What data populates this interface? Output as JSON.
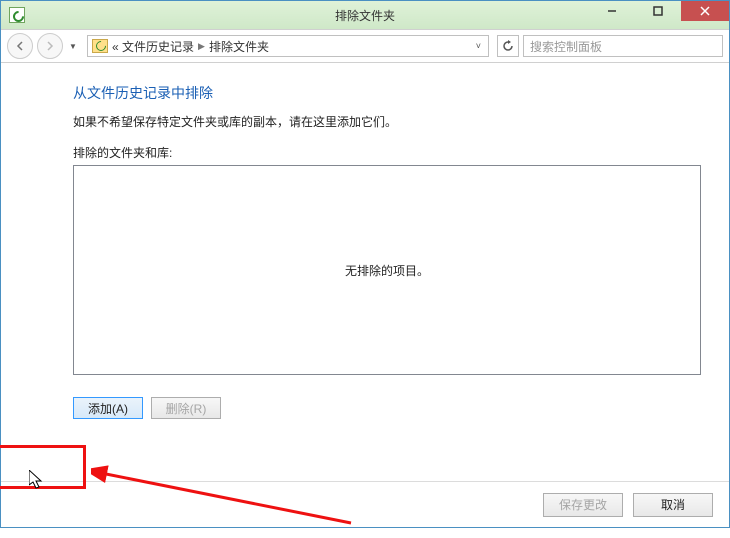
{
  "titlebar": {
    "title": "排除文件夹"
  },
  "nav": {
    "crumb1": "« 文件历史记录",
    "crumb2": "排除文件夹",
    "search_placeholder": "搜索控制面板"
  },
  "content": {
    "heading": "从文件历史记录中排除",
    "desc": "如果不希望保存特定文件夹或库的副本，请在这里添加它们。",
    "list_label": "排除的文件夹和库:",
    "empty_text": "无排除的项目。",
    "add_label": "添加(A)",
    "remove_label": "删除(R)"
  },
  "footer": {
    "save_label": "保存更改",
    "cancel_label": "取消"
  }
}
